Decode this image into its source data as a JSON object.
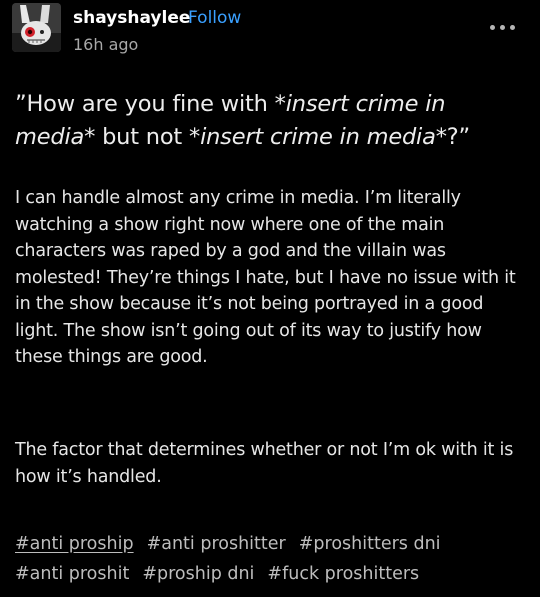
{
  "post": {
    "username": "shayshaylee",
    "follow_label": "Follow",
    "timestamp": "16h ago",
    "quote": {
      "open": "”How are you fine with ",
      "it1": "*insert crime in media*",
      "mid": " but not ",
      "it2": "*insert crime in media*",
      "close": "?”"
    },
    "paragraphs": [
      "I can handle almost any crime in media. I’m literally watching a show right now where one of the main characters was raped by a god and the villain was molested! They’re things I hate, but I have no issue with it in the show because it’s not being portrayed in a good light. The show isn’t going out of its way to justify how these things are good.",
      "The factor that determines whether or not I’m ok with it is how it’s handled."
    ],
    "tags": [
      "#anti proship",
      "#anti proshitter",
      "#proshitters dni",
      "#anti proshit",
      "#proship dni",
      "#fuck proshitters"
    ]
  },
  "icons": {
    "avatar": "avatar-image",
    "more": "more-options-icon"
  },
  "colors": {
    "background": "#000000",
    "follow": "#3aa0ff",
    "text": "#e6e6e6",
    "tags": "#bdbdbd"
  }
}
